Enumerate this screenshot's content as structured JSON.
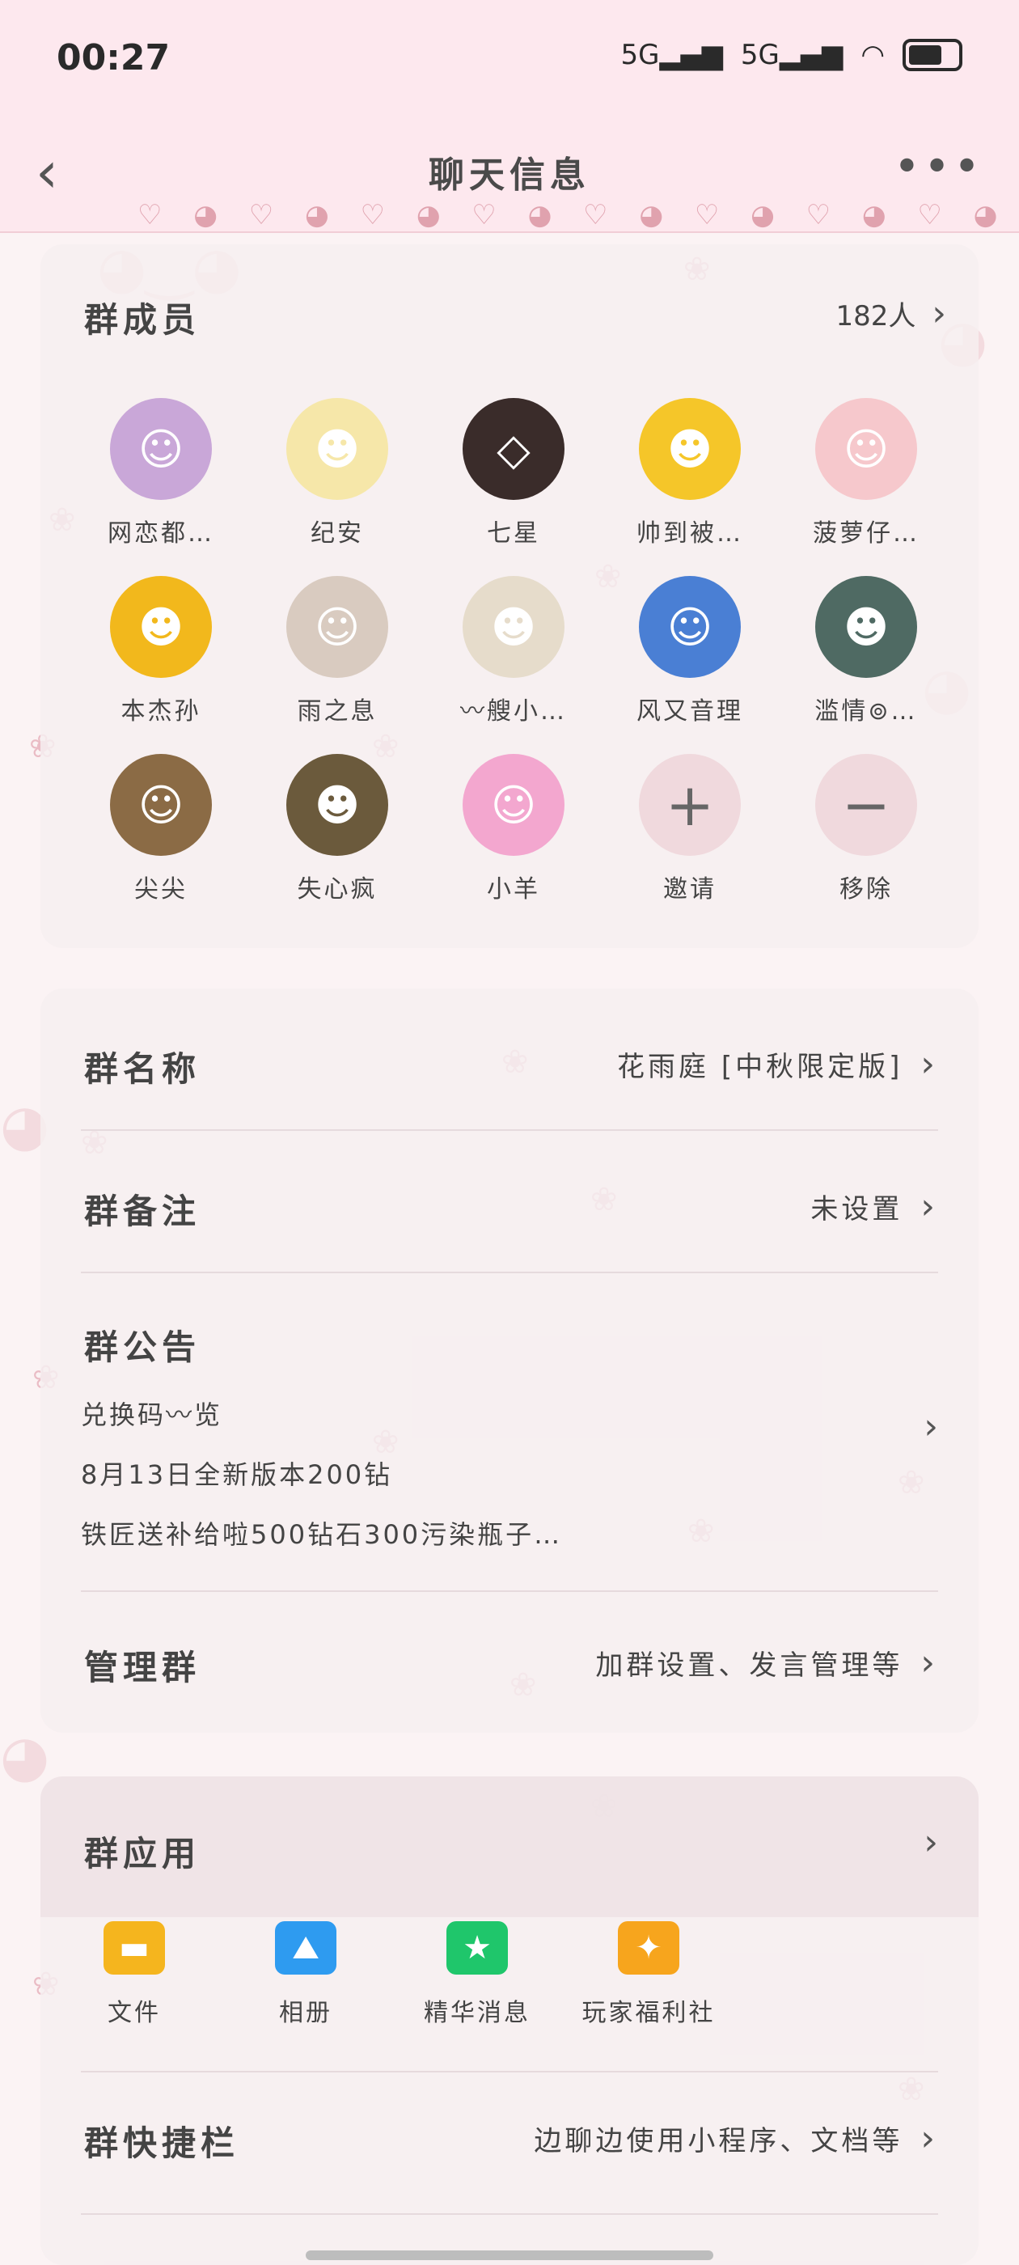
{
  "status": {
    "time": "00:27",
    "signal1": "5G",
    "signal2": "5G"
  },
  "nav": {
    "title": "聊天信息",
    "back_icon": "chevron-left-icon",
    "more_icon": "more-icon",
    "trim": "♡ ◕ ♡ ◕ ♡ ◕ ♡ ◕ ♡ ◕ ♡ ◕ ♡ ◕ ♡ ◕ ♡ ◕"
  },
  "members": {
    "title": "群成员",
    "count": "182人",
    "items": [
      {
        "name": "网恋都…",
        "color": "#c9a7d8",
        "glyph": "☺"
      },
      {
        "name": "纪安",
        "color": "#f6e7a9",
        "glyph": "☻"
      },
      {
        "name": "七星",
        "color": "#3a2c2a",
        "glyph": "◇"
      },
      {
        "name": "帅到被…",
        "color": "#f5c629",
        "glyph": "☻"
      },
      {
        "name": "菠萝仔…",
        "color": "#f6c8cc",
        "glyph": "☺"
      },
      {
        "name": "本杰孙",
        "color": "#f2b81c",
        "glyph": "☻"
      },
      {
        "name": "雨之息",
        "color": "#d9cbc0",
        "glyph": "☺"
      },
      {
        "name": "〰艘小…",
        "color": "#e6dccb",
        "glyph": "☻"
      },
      {
        "name": "风又音理",
        "color": "#4a7fd4",
        "glyph": "☺"
      },
      {
        "name": "滥情⊚…",
        "color": "#4f6a63",
        "glyph": "☻"
      },
      {
        "name": "尖尖",
        "color": "#8b6b45",
        "glyph": "☺"
      },
      {
        "name": "失心疯",
        "color": "#6b5a3c",
        "glyph": "☻"
      },
      {
        "name": "小羊",
        "color": "#f3a7cf",
        "glyph": "☺"
      }
    ],
    "invite_label": "邀请",
    "remove_label": "移除"
  },
  "info": {
    "group_name_label": "群名称",
    "group_name_value": "花雨庭 [中秋限定版]",
    "remark_label": "群备注",
    "remark_value": "未设置",
    "notice_label": "群公告",
    "notice_lines": [
      "兑换码〰览",
      "8月13日全新版本200钻",
      "铁匠送补给啦500钻石300污染瓶子…"
    ],
    "manage_label": "管理群",
    "manage_value": "加群设置、发言管理等"
  },
  "apps": {
    "title": "群应用",
    "items": [
      {
        "label": "文件",
        "icon": "folder-icon",
        "color": "#f5b51e",
        "glyph": "▬"
      },
      {
        "label": "相册",
        "icon": "photo-icon",
        "color": "#2e9bf0",
        "glyph": "⛰"
      },
      {
        "label": "精华消息",
        "icon": "star-bubble-icon",
        "color": "#1fc66b",
        "glyph": "★"
      },
      {
        "label": "玩家福利社",
        "icon": "gift-hand-icon",
        "color": "#f7a51d",
        "glyph": "✦"
      }
    ]
  },
  "shortcut": {
    "label": "群快捷栏",
    "value": "边聊边使用小程序、文档等"
  }
}
